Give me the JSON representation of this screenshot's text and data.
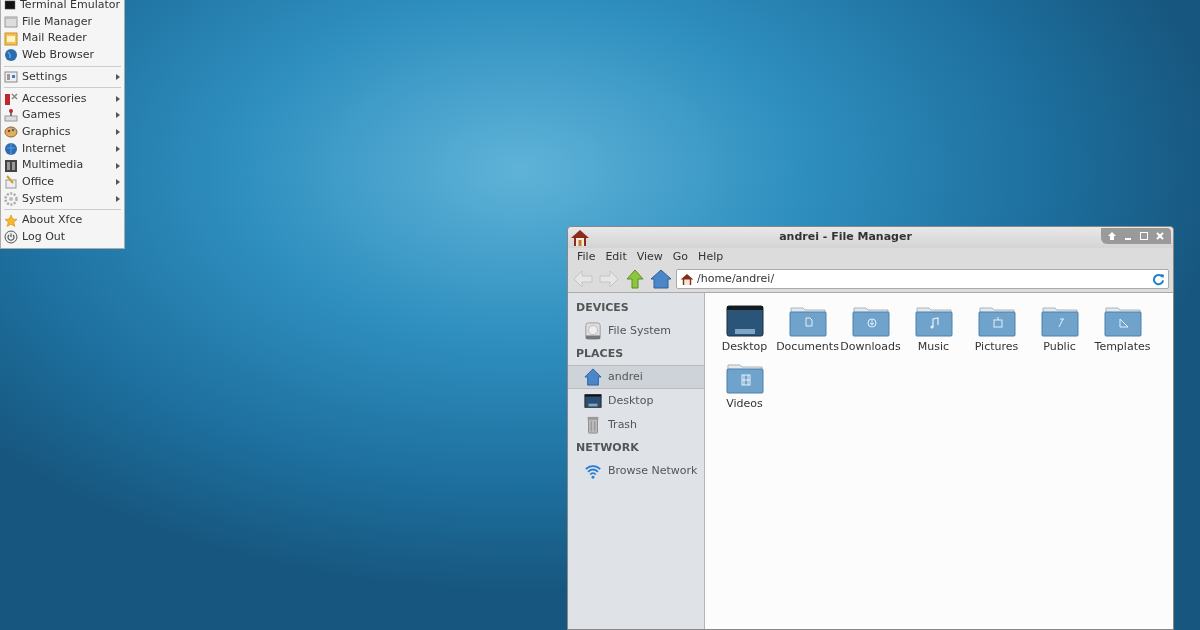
{
  "app_menu": {
    "items": [
      {
        "kind": "item",
        "label": "Terminal Emulator",
        "submenu": false
      },
      {
        "kind": "item",
        "label": "File Manager",
        "submenu": false
      },
      {
        "kind": "item",
        "label": "Mail Reader",
        "submenu": false
      },
      {
        "kind": "item",
        "label": "Web Browser",
        "submenu": false
      },
      {
        "kind": "separator"
      },
      {
        "kind": "item",
        "label": "Settings",
        "submenu": true
      },
      {
        "kind": "separator"
      },
      {
        "kind": "item",
        "label": "Accessories",
        "submenu": true
      },
      {
        "kind": "item",
        "label": "Games",
        "submenu": true
      },
      {
        "kind": "item",
        "label": "Graphics",
        "submenu": true
      },
      {
        "kind": "item",
        "label": "Internet",
        "submenu": true
      },
      {
        "kind": "item",
        "label": "Multimedia",
        "submenu": true
      },
      {
        "kind": "item",
        "label": "Office",
        "submenu": true
      },
      {
        "kind": "item",
        "label": "System",
        "submenu": true
      },
      {
        "kind": "separator"
      },
      {
        "kind": "item",
        "label": "About Xfce",
        "submenu": false
      },
      {
        "kind": "item",
        "label": "Log Out",
        "submenu": false
      }
    ]
  },
  "window": {
    "title": "andrei - File Manager",
    "menubar": [
      "File",
      "Edit",
      "View",
      "Go",
      "Help"
    ],
    "toolbar": {
      "back_disabled": true,
      "forward_disabled": true,
      "location": "/home/andrei/"
    },
    "sidebar": {
      "sections": [
        {
          "title": "DEVICES",
          "items": [
            {
              "label": "File System",
              "selected": false
            }
          ]
        },
        {
          "title": "PLACES",
          "items": [
            {
              "label": "andrei",
              "selected": true
            },
            {
              "label": "Desktop",
              "selected": false
            },
            {
              "label": "Trash",
              "selected": false
            }
          ]
        },
        {
          "title": "NETWORK",
          "items": [
            {
              "label": "Browse Network",
              "selected": false
            }
          ]
        }
      ]
    },
    "files": [
      {
        "kind": "desktop",
        "name": "Desktop"
      },
      {
        "kind": "folder",
        "name": "Documents"
      },
      {
        "kind": "folder",
        "name": "Downloads"
      },
      {
        "kind": "folder",
        "name": "Music"
      },
      {
        "kind": "folder",
        "name": "Pictures"
      },
      {
        "kind": "folder",
        "name": "Public"
      },
      {
        "kind": "folder",
        "name": "Templates"
      },
      {
        "kind": "folder",
        "name": "Videos"
      }
    ]
  }
}
